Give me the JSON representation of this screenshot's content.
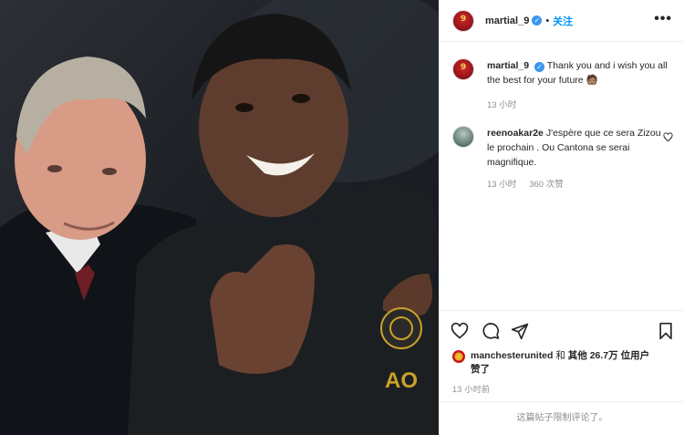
{
  "post": {
    "username": "martial_9",
    "verified_glyph": "✓",
    "follow_label": "关注",
    "more_label": "•••",
    "separator": "•"
  },
  "caption": {
    "username": "martial_9",
    "text": "Thank you and i wish you all the best for your future 🧑🏽",
    "time": "13 小时"
  },
  "comment": {
    "username": "reenoakar2e",
    "text": "J'espère que ce sera Zizou le prochain . Ou Cantona se serai magnifique.",
    "time": "13 小时",
    "likes": "360 次赞"
  },
  "likes": {
    "account": "manchesterunited",
    "connector": " 和 ",
    "others": "其他 26.7万 位用户",
    "suffix": "赞了"
  },
  "post_time": "13 小时前",
  "comments_limited": "这篇帖子限制评论了。",
  "icons": {
    "like": "heart-icon",
    "comment": "comment-icon",
    "share": "share-icon",
    "save": "bookmark-icon",
    "comment_like": "heart-icon",
    "options": "more-options-icon"
  },
  "colors": {
    "accent": "#0095f6",
    "verified": "#3897f0",
    "text": "#262626",
    "muted": "#8e8e8e",
    "border": "#efefef"
  }
}
